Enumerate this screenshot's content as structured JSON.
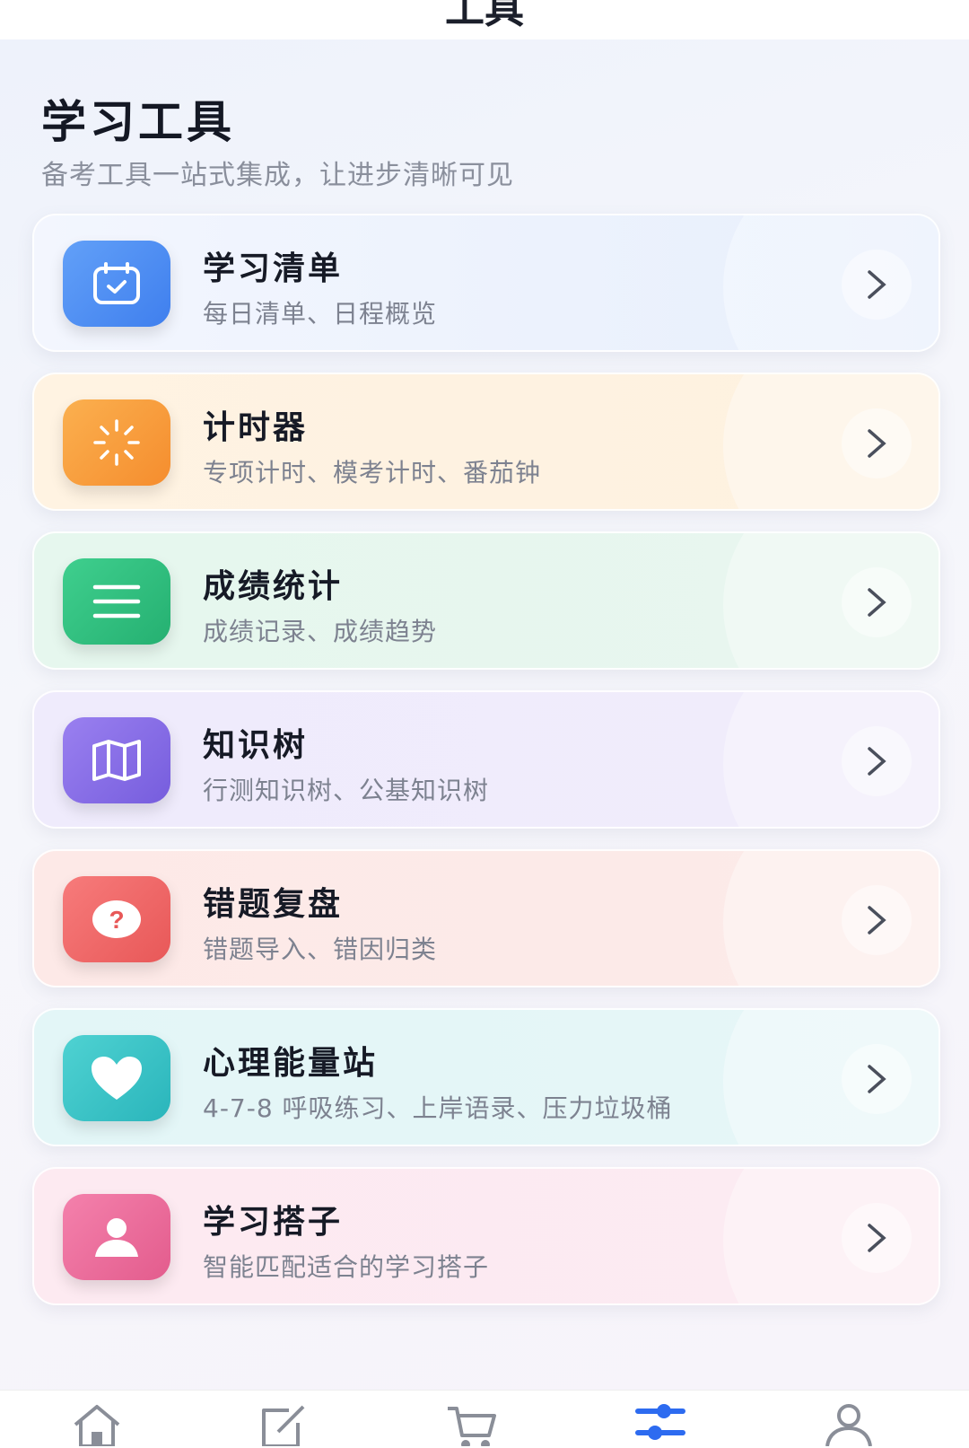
{
  "header": {
    "title": "工具"
  },
  "page": {
    "title": "学习工具",
    "subtitle": "备考工具一站式集成，让进步清晰可见"
  },
  "cards": [
    {
      "title": "学习清单",
      "desc": "每日清单、日程概览",
      "icon": "calendar-check-icon",
      "color": "#4f8ef3"
    },
    {
      "title": "计时器",
      "desc": "专项计时、模考计时、番茄钟",
      "icon": "timer-icon",
      "color": "#f79a3e"
    },
    {
      "title": "成绩统计",
      "desc": "成绩记录、成绩趋势",
      "icon": "list-icon",
      "color": "#2fbf7f"
    },
    {
      "title": "知识树",
      "desc": "行测知识树、公基知识树",
      "icon": "map-icon",
      "color": "#8a6fe6"
    },
    {
      "title": "错题复盘",
      "desc": "错题导入、错因归类",
      "icon": "question-icon",
      "color": "#f26868"
    },
    {
      "title": "心理能量站",
      "desc": "4-7-8 呼吸练习、上岸语录、压力垃圾桶",
      "icon": "heart-icon",
      "color": "#36c5c8"
    },
    {
      "title": "学习搭子",
      "desc": "智能匹配适合的学习搭子",
      "icon": "person-icon",
      "color": "#ee6d9c"
    }
  ],
  "nav": {
    "items": [
      {
        "name": "home-icon",
        "active": false
      },
      {
        "name": "edit-icon",
        "active": false
      },
      {
        "name": "cart-icon",
        "active": false
      },
      {
        "name": "sliders-icon",
        "active": true
      },
      {
        "name": "user-icon",
        "active": false
      }
    ],
    "active_color": "#2d6bf0",
    "inactive_color": "#8a8e98"
  }
}
